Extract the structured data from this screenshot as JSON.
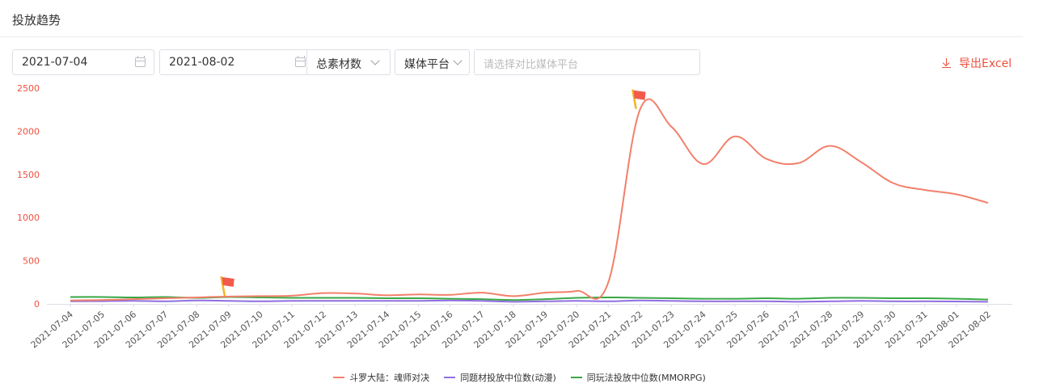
{
  "header": {
    "title": "投放趋势"
  },
  "filters": {
    "start_date": "2021-07-04",
    "end_date": "2021-08-02",
    "metric": "总素材数",
    "platform": "媒体平台",
    "compare_placeholder": "请选择对比媒体平台",
    "export_label": "导出Excel"
  },
  "colors": {
    "accent": "#f0503c",
    "series1": "#f2806b",
    "series2": "#8f6fe0",
    "series3": "#3aa845",
    "y_tick": "#f0503c",
    "flag": "#f25a4a",
    "flag_pole": "#f5b51d"
  },
  "chart_data": {
    "type": "line",
    "x": [
      "2021-07-04",
      "2021-07-05",
      "2021-07-06",
      "2021-07-07",
      "2021-07-08",
      "2021-07-09",
      "2021-07-10",
      "2021-07-11",
      "2021-07-12",
      "2021-07-13",
      "2021-07-14",
      "2021-07-15",
      "2021-07-16",
      "2021-07-17",
      "2021-07-18",
      "2021-07-19",
      "2021-07-20",
      "2021-07-21",
      "2021-07-22",
      "2021-07-23",
      "2021-07-24",
      "2021-07-25",
      "2021-07-26",
      "2021-07-27",
      "2021-07-28",
      "2021-07-29",
      "2021-07-30",
      "2021-07-31",
      "2021-08-01",
      "2021-08-02"
    ],
    "ylim": [
      0,
      2500
    ],
    "yticks": [
      0,
      500,
      1000,
      1500,
      2000,
      2500
    ],
    "grid": false,
    "legend_position": "bottom",
    "series": [
      {
        "name": "斗罗大陆：魂师对决",
        "color": "#f2806b",
        "values": [
          40,
          45,
          55,
          65,
          75,
          85,
          90,
          95,
          125,
          120,
          100,
          110,
          105,
          130,
          90,
          130,
          150,
          250,
          2250,
          2050,
          1620,
          1940,
          1680,
          1630,
          1830,
          1640,
          1400,
          1320,
          1270,
          1170
        ]
      },
      {
        "name": "同题材投放中位数(动漫)",
        "color": "#8f6fe0",
        "values": [
          30,
          32,
          35,
          30,
          40,
          35,
          30,
          35,
          35,
          35,
          35,
          35,
          40,
          35,
          25,
          30,
          35,
          30,
          40,
          35,
          30,
          30,
          30,
          25,
          30,
          35,
          30,
          30,
          28,
          25
        ]
      },
      {
        "name": "同玩法投放中位数(MMORPG)",
        "color": "#3aa845",
        "values": [
          80,
          80,
          75,
          80,
          70,
          80,
          75,
          70,
          70,
          70,
          65,
          65,
          60,
          55,
          45,
          55,
          70,
          75,
          70,
          65,
          60,
          60,
          65,
          60,
          70,
          70,
          65,
          65,
          60,
          50
        ]
      }
    ],
    "markers": [
      {
        "type": "flag",
        "series": 0,
        "x": "2021-07-09"
      },
      {
        "type": "flag",
        "series": 0,
        "x": "2021-07-22"
      }
    ]
  }
}
